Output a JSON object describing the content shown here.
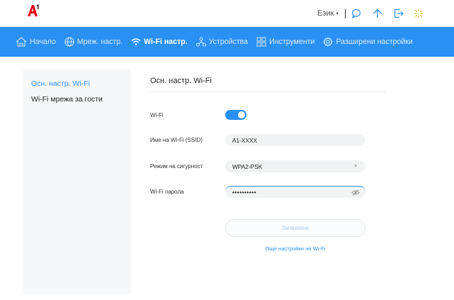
{
  "brand": {
    "logo_text": "A1",
    "accent": "#e2001a",
    "nav_bg": "#2a90f4"
  },
  "header": {
    "language_label": "Език",
    "icons": [
      "chat-icon",
      "upload-arrow-icon",
      "logout-icon",
      "loading-spinner-icon"
    ]
  },
  "nav": {
    "items": [
      {
        "label": "Начало",
        "icon": "home-icon"
      },
      {
        "label": "Мреж. настр.",
        "icon": "globe-icon"
      },
      {
        "label": "Wi-Fi настр.",
        "icon": "wifi-icon",
        "active": true
      },
      {
        "label": "Устройства",
        "icon": "devices-icon"
      },
      {
        "label": "Инструменти",
        "icon": "tools-icon"
      },
      {
        "label": "Разширени настройки",
        "icon": "gear-icon"
      }
    ]
  },
  "sidebar": {
    "items": [
      {
        "label": "Осн. настр. Wi-Fi",
        "active": true
      },
      {
        "label": "Wi-Fi мрежа за гости"
      }
    ]
  },
  "main": {
    "title": "Осн. настр. Wi-Fi",
    "wifi_label": "Wi-Fi",
    "wifi_enabled": true,
    "ssid_label": "Име на Wi-Fi (SSID)",
    "ssid_value": "A1-XXXX",
    "security_label": "Режим на сигурност",
    "security_value": "WPA2-PSK",
    "password_label": "Wi-Fi парола",
    "password_value": "••••••••••",
    "save_label": "Запазване",
    "more_link": "Още настройки на Wi-Fi"
  }
}
